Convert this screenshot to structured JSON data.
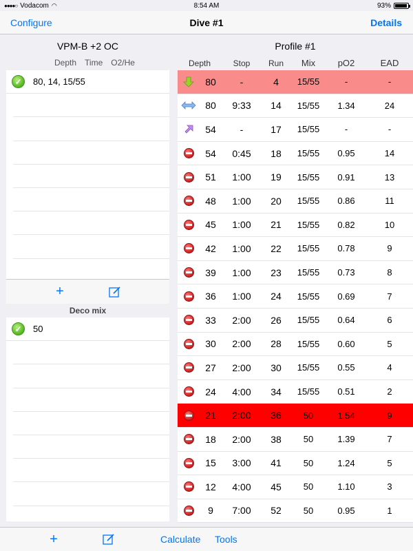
{
  "status": {
    "carrier": "Vodacom",
    "time": "8:54 AM",
    "battery": "93%"
  },
  "nav": {
    "left": "Configure",
    "title": "Dive #1",
    "right": "Details"
  },
  "left": {
    "title": "VPM-B  +2  OC",
    "headers": [
      "Depth",
      "Time",
      "O2/He"
    ],
    "levels": [
      "80, 14, 15/55"
    ],
    "deco_header": "Deco mix",
    "deco_mixes": [
      "50"
    ]
  },
  "right": {
    "title": "Profile #1",
    "headers": {
      "depth": "Depth",
      "stop": "Stop",
      "run": "Run",
      "mix": "Mix",
      "po2": "pO2",
      "ead": "EAD"
    },
    "rows": [
      {
        "icon": "descent-arrow-icon",
        "depth": "80",
        "stop": "-",
        "run": "4",
        "mix": "15/55",
        "po2": "-",
        "ead": "-",
        "hl": "pink"
      },
      {
        "icon": "level-arrow-icon",
        "depth": "80",
        "stop": "9:33",
        "run": "14",
        "mix": "15/55",
        "po2": "1.34",
        "ead": "24",
        "hl": ""
      },
      {
        "icon": "ascent-arrow-icon",
        "depth": "54",
        "stop": "-",
        "run": "17",
        "mix": "15/55",
        "po2": "-",
        "ead": "-",
        "hl": ""
      },
      {
        "icon": "stop-icon",
        "depth": "54",
        "stop": "0:45",
        "run": "18",
        "mix": "15/55",
        "po2": "0.95",
        "ead": "14",
        "hl": ""
      },
      {
        "icon": "stop-icon",
        "depth": "51",
        "stop": "1:00",
        "run": "19",
        "mix": "15/55",
        "po2": "0.91",
        "ead": "13",
        "hl": ""
      },
      {
        "icon": "stop-icon",
        "depth": "48",
        "stop": "1:00",
        "run": "20",
        "mix": "15/55",
        "po2": "0.86",
        "ead": "11",
        "hl": ""
      },
      {
        "icon": "stop-icon",
        "depth": "45",
        "stop": "1:00",
        "run": "21",
        "mix": "15/55",
        "po2": "0.82",
        "ead": "10",
        "hl": ""
      },
      {
        "icon": "stop-icon",
        "depth": "42",
        "stop": "1:00",
        "run": "22",
        "mix": "15/55",
        "po2": "0.78",
        "ead": "9",
        "hl": ""
      },
      {
        "icon": "stop-icon",
        "depth": "39",
        "stop": "1:00",
        "run": "23",
        "mix": "15/55",
        "po2": "0.73",
        "ead": "8",
        "hl": ""
      },
      {
        "icon": "stop-icon",
        "depth": "36",
        "stop": "1:00",
        "run": "24",
        "mix": "15/55",
        "po2": "0.69",
        "ead": "7",
        "hl": ""
      },
      {
        "icon": "stop-icon",
        "depth": "33",
        "stop": "2:00",
        "run": "26",
        "mix": "15/55",
        "po2": "0.64",
        "ead": "6",
        "hl": ""
      },
      {
        "icon": "stop-icon",
        "depth": "30",
        "stop": "2:00",
        "run": "28",
        "mix": "15/55",
        "po2": "0.60",
        "ead": "5",
        "hl": ""
      },
      {
        "icon": "stop-icon",
        "depth": "27",
        "stop": "2:00",
        "run": "30",
        "mix": "15/55",
        "po2": "0.55",
        "ead": "4",
        "hl": ""
      },
      {
        "icon": "stop-icon",
        "depth": "24",
        "stop": "4:00",
        "run": "34",
        "mix": "15/55",
        "po2": "0.51",
        "ead": "2",
        "hl": ""
      },
      {
        "icon": "stop-icon",
        "depth": "21",
        "stop": "2:00",
        "run": "36",
        "mix": "50",
        "po2": "1.54",
        "ead": "9",
        "hl": "red"
      },
      {
        "icon": "stop-icon",
        "depth": "18",
        "stop": "2:00",
        "run": "38",
        "mix": "50",
        "po2": "1.39",
        "ead": "7",
        "hl": ""
      },
      {
        "icon": "stop-icon",
        "depth": "15",
        "stop": "3:00",
        "run": "41",
        "mix": "50",
        "po2": "1.24",
        "ead": "5",
        "hl": ""
      },
      {
        "icon": "stop-icon",
        "depth": "12",
        "stop": "4:00",
        "run": "45",
        "mix": "50",
        "po2": "1.10",
        "ead": "3",
        "hl": ""
      },
      {
        "icon": "stop-icon",
        "depth": "9",
        "stop": "7:00",
        "run": "52",
        "mix": "50",
        "po2": "0.95",
        "ead": "1",
        "hl": ""
      }
    ]
  },
  "bottom": {
    "calculate": "Calculate",
    "tools": "Tools"
  },
  "colors": {
    "accent": "#0076ff",
    "warning_row": "#f98b8b",
    "danger_row": "#ff0000"
  }
}
